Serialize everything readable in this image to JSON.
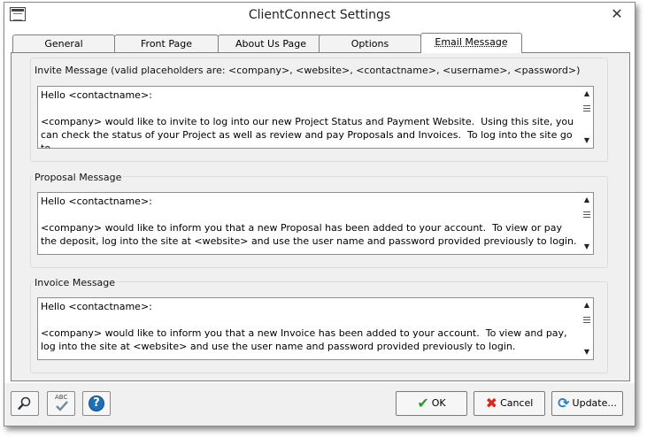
{
  "window": {
    "title": "ClientConnect Settings",
    "close_glyph": "✕"
  },
  "tabs": [
    {
      "label": "General"
    },
    {
      "label": "Front Page"
    },
    {
      "label": "About Us Page"
    },
    {
      "label": "Options"
    },
    {
      "label": "Email Message",
      "active": true
    }
  ],
  "invite": {
    "label": "Invite Message (valid placeholders are: <company>, <website>, <contactname>, <username>, <password>)",
    "text": "Hello <contactname>:\n\n<company> would like to invite to log into our new Project Status and Payment Website.  Using this site, you can check the status of your Project as well as review and pay Proposals and Invoices.  To log into the site go to"
  },
  "proposal": {
    "label": "Proposal Message",
    "text": "Hello <contactname>:\n\n<company> would like to inform you that a new Proposal has been added to your account.  To view or pay the deposit, log into the site at <website> and use the user name and password provided previously to login."
  },
  "invoice": {
    "label": "Invoice Message",
    "text": "Hello <contactname>:\n\n<company> would like to inform you that a new Invoice has been added to your account.  To view and pay, log into the site at <website> and use the user name and password provided previously to login."
  },
  "scroll_glyphs": {
    "up": "▲",
    "down": "▼"
  },
  "buttons": {
    "ok": "OK",
    "cancel": "Cancel",
    "update": "Update...",
    "spell_abc": "ABC",
    "help_glyph": "?"
  },
  "icons": {
    "search": "search-icon",
    "spellcheck": "spellcheck-icon",
    "help": "help-icon",
    "ok": "check-icon",
    "cancel": "x-icon",
    "update": "refresh-icon"
  },
  "colors": {
    "accent": "#1f6fb8",
    "ok_green": "#2a9a2a",
    "cancel_red": "#d9261c"
  }
}
